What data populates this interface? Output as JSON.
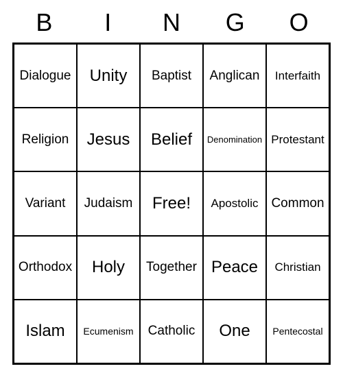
{
  "title_letters": [
    "B",
    "I",
    "N",
    "G",
    "O"
  ],
  "grid": [
    [
      {
        "text": "Dialogue",
        "size": "medium"
      },
      {
        "text": "Unity",
        "size": "large"
      },
      {
        "text": "Baptist",
        "size": "medium"
      },
      {
        "text": "Anglican",
        "size": "medium"
      },
      {
        "text": "Interfaith",
        "size": ""
      }
    ],
    [
      {
        "text": "Religion",
        "size": "medium"
      },
      {
        "text": "Jesus",
        "size": "large"
      },
      {
        "text": "Belief",
        "size": "large"
      },
      {
        "text": "Denomination",
        "size": "xsmall"
      },
      {
        "text": "Protestant",
        "size": ""
      }
    ],
    [
      {
        "text": "Variant",
        "size": "medium"
      },
      {
        "text": "Judaism",
        "size": "medium"
      },
      {
        "text": "Free!",
        "size": "large"
      },
      {
        "text": "Apostolic",
        "size": ""
      },
      {
        "text": "Common",
        "size": "medium"
      }
    ],
    [
      {
        "text": "Orthodox",
        "size": "medium"
      },
      {
        "text": "Holy",
        "size": "large"
      },
      {
        "text": "Together",
        "size": "medium"
      },
      {
        "text": "Peace",
        "size": "large"
      },
      {
        "text": "Christian",
        "size": ""
      }
    ],
    [
      {
        "text": "Islam",
        "size": "large"
      },
      {
        "text": "Ecumenism",
        "size": "small"
      },
      {
        "text": "Catholic",
        "size": "medium"
      },
      {
        "text": "One",
        "size": "large"
      },
      {
        "text": "Pentecostal",
        "size": "small"
      }
    ]
  ]
}
